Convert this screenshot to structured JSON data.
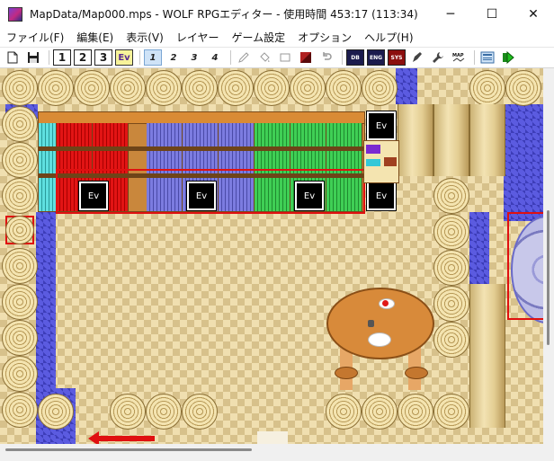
{
  "window": {
    "title": "MapData/Map000.mps - WOLF RPGエディター - 使用時間 453:17 (113:34)",
    "minimize": "─",
    "maximize": "☐",
    "close": "✕"
  },
  "menu": {
    "file": "ファイル(F)",
    "edit": "編集(E)",
    "view": "表示(V)",
    "layer": "レイヤー",
    "game_settings": "ゲーム設定",
    "options": "オプション",
    "help": "ヘルプ(H)"
  },
  "toolbar": {
    "layer1": "1",
    "layer2": "2",
    "layer3": "3",
    "event_mode": "Ev",
    "tile_1": "1",
    "tile_2": "2",
    "tile_3": "3",
    "tile_4": "4",
    "db_tag": "DB",
    "eng_tag": "ENG",
    "sys_tag": "SYS",
    "map_tag": "MAP"
  },
  "map": {
    "event_label": "Ev",
    "colors": {
      "accent_red": "#e01010",
      "floor_light": "#f0dfb0",
      "floor_dark": "#d7c18b",
      "wall_blue": "#5b5be0"
    }
  }
}
